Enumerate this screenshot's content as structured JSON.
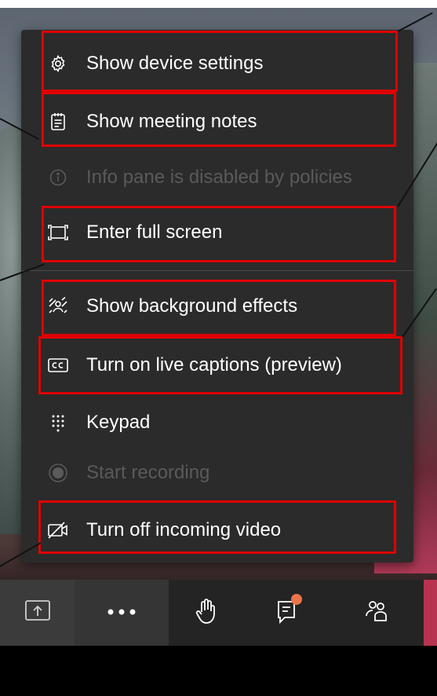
{
  "menu": {
    "items": [
      {
        "label": "Show device settings",
        "icon": "gear-icon",
        "enabled": true
      },
      {
        "label": "Show meeting notes",
        "icon": "notes-icon",
        "enabled": true
      },
      {
        "label": "Info pane is disabled by policies",
        "icon": "info-icon",
        "enabled": false
      },
      {
        "label": "Enter full screen",
        "icon": "fullscreen-icon",
        "enabled": true
      },
      {
        "label": "Show background effects",
        "icon": "background-effects-icon",
        "enabled": true
      },
      {
        "label": "Turn on live captions (preview)",
        "icon": "captions-icon",
        "enabled": true
      },
      {
        "label": "Keypad",
        "icon": "keypad-icon",
        "enabled": true
      },
      {
        "label": "Start recording",
        "icon": "record-icon",
        "enabled": false
      },
      {
        "label": "Turn off incoming video",
        "icon": "video-off-icon",
        "enabled": true
      }
    ]
  },
  "toolbar": {
    "buttons": [
      {
        "icon": "share-screen-icon"
      },
      {
        "icon": "more-actions-icon"
      },
      {
        "icon": "raise-hand-icon"
      },
      {
        "icon": "chat-icon"
      },
      {
        "icon": "participants-icon"
      }
    ]
  },
  "colors": {
    "menu_bg": "#2b2b2b",
    "toolbar_bg": "#242424",
    "highlight": "#e00000",
    "disabled_text": "#5a5a5a",
    "chat_badge": "#e97548",
    "accent_end": "#b8334f"
  }
}
